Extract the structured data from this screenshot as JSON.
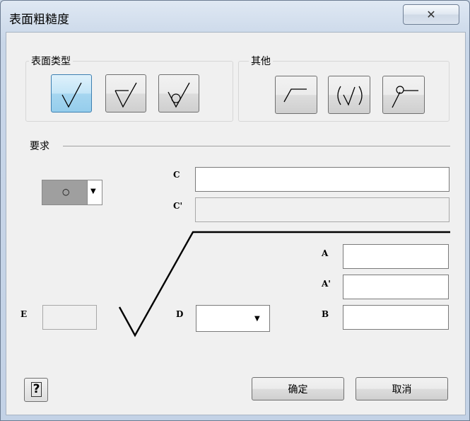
{
  "window": {
    "title": "表面粗糙度",
    "close_glyph": "✕"
  },
  "surface_type": {
    "label": "表面类型",
    "buttons": [
      {
        "icon": "basic-surface-icon",
        "active": true
      },
      {
        "icon": "material-removal-required-icon",
        "active": false
      },
      {
        "icon": "material-removal-prohibited-icon",
        "active": false
      }
    ]
  },
  "other": {
    "label": "其他",
    "buttons": [
      {
        "icon": "lay-extension-icon"
      },
      {
        "icon": "all-around-parenthesis-icon"
      },
      {
        "icon": "leader-circle-icon"
      }
    ]
  },
  "requirements": {
    "label": "要求",
    "lay_direction_value": "○",
    "fields": {
      "c_label": "C",
      "c_value": "",
      "c_prime_label": "C'",
      "c_prime_value": "",
      "a_label": "A",
      "a_value": "",
      "a_prime_label": "A'",
      "a_prime_value": "",
      "b_label": "B",
      "b_value": "",
      "d_label": "D",
      "d_value": "",
      "e_label": "E",
      "e_value": ""
    }
  },
  "footer": {
    "ok_label": "确定",
    "cancel_label": "取消",
    "help_glyph": "?"
  }
}
